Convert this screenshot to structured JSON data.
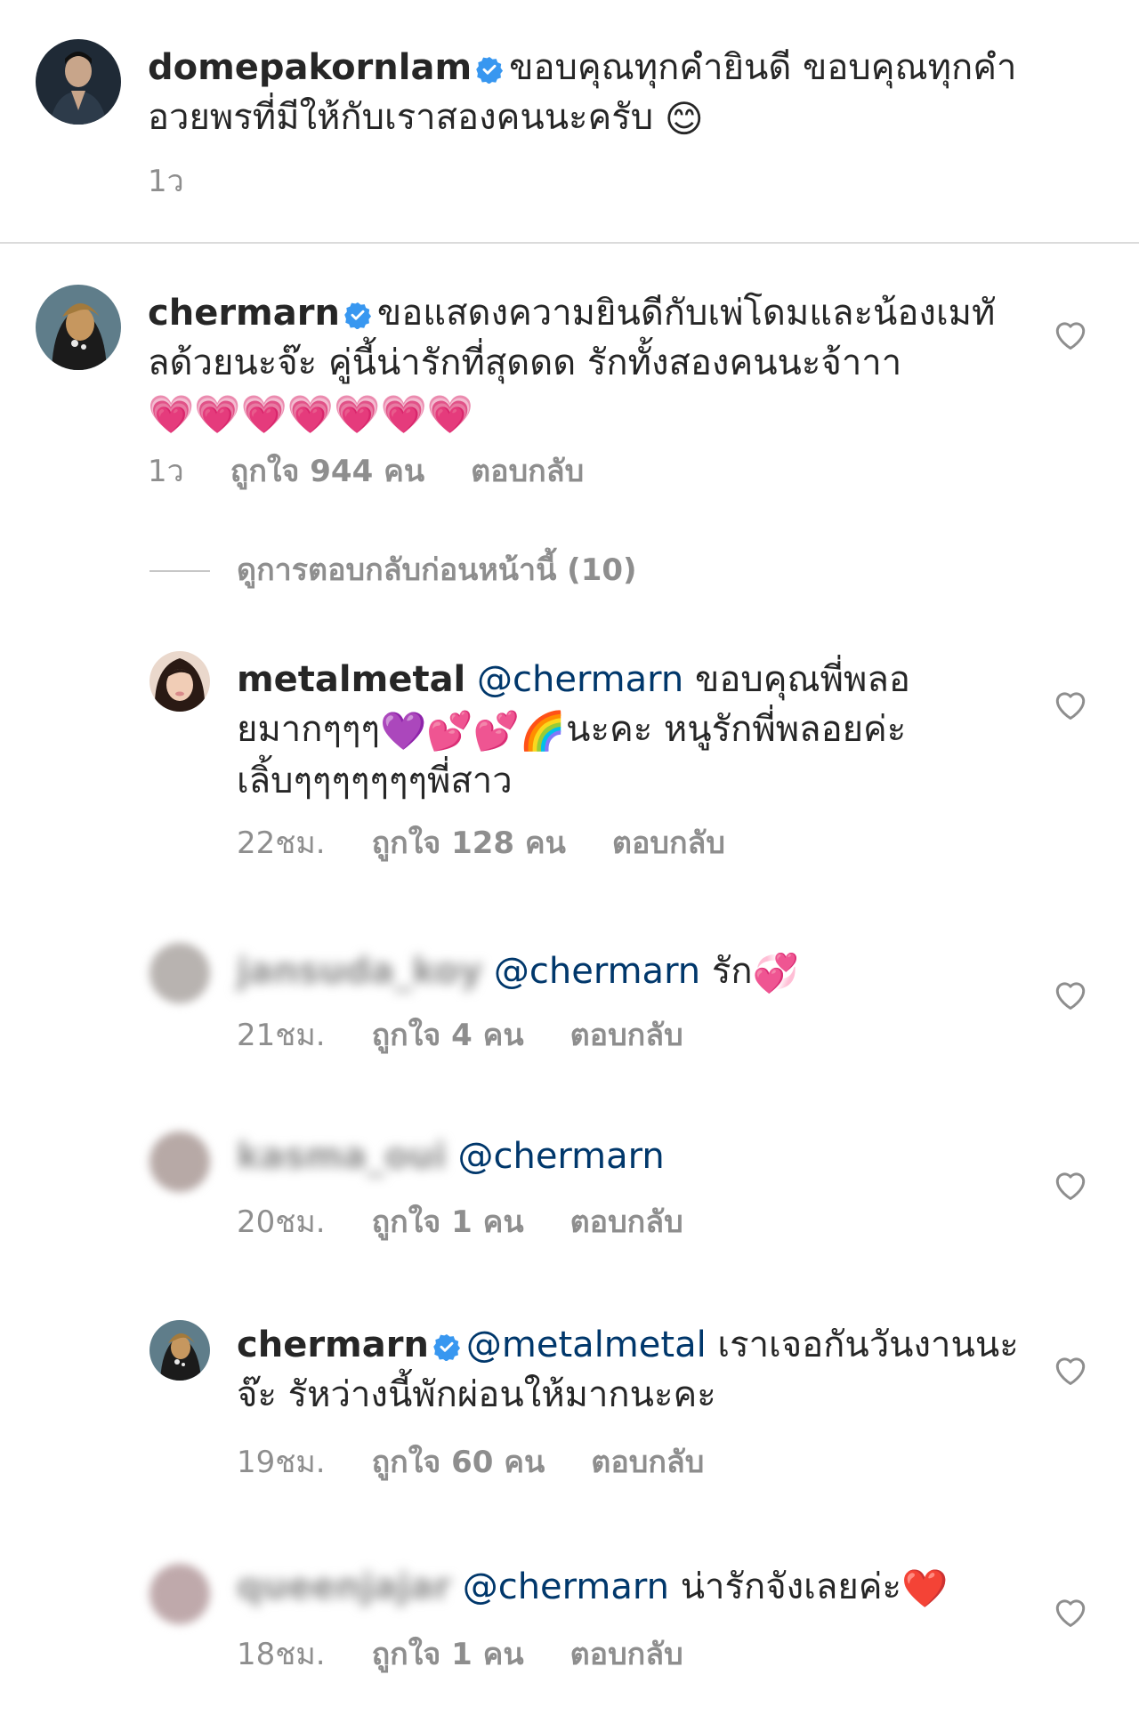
{
  "comments": [
    {
      "username": "domepakornlam",
      "text": "ขอบคุณทุกคำยินดี ขอบคุณทุกคำอวยพรที่มีให้กับเราสองคนนะครับ",
      "emoji": "😊",
      "time": "1ว"
    },
    {
      "username": "chermarn",
      "text": "ขอแสดงความยินดีกับเพ่โดมและน้องเมทัลด้วยนะจ๊ะ คู่นี้น่ารักที่สุดดด รักทั้งสองคนนะจ้าาา",
      "emoji": "💗💗💗💗💗💗💗",
      "time": "1ว",
      "likes": "ถูกใจ 944 คน",
      "reply": "ตอบกลับ"
    }
  ],
  "view_replies": "ดูการตอบกลับก่อนหน้านี้ (10)",
  "replies": [
    {
      "username": "metalmetal",
      "mention": "@chermarn",
      "text_a": "ขอบคุณพี่พลอยมากๆๆๆ",
      "emoji": "💜💕💕🌈",
      "text_b": "นะคะ หนูรักพี่พลอยค่ะเลิ้บๆๆๆๆๆๆๆพี่สาว",
      "time": "22ชม.",
      "likes": "ถูกใจ 128 คน",
      "reply": "ตอบกลับ"
    },
    {
      "username": "jansuda_koy",
      "mention": "@chermarn",
      "text": "รัก",
      "emoji": "💞",
      "time": "21ชม.",
      "likes": "ถูกใจ 4 คน",
      "reply": "ตอบกลับ"
    },
    {
      "username": "kasma_oui",
      "mention": "@chermarn",
      "time": "20ชม.",
      "likes": "ถูกใจ 1 คน",
      "reply": "ตอบกลับ"
    },
    {
      "username": "chermarn",
      "mention": "@metalmetal",
      "text": "เราเจอกันวันงานนะจ๊ะ รัหว่างนี้พักผ่อนให้มากนะคะ",
      "time": "19ชม.",
      "likes": "ถูกใจ 60 คน",
      "reply": "ตอบกลับ"
    },
    {
      "username": "queenjajar",
      "mention": "@chermarn",
      "text": "น่ารักจังเลยค่ะ",
      "emoji": "❤️",
      "time": "18ชม.",
      "likes": "ถูกใจ 1 คน",
      "reply": "ตอบกลับ"
    }
  ],
  "colors": {
    "text": "#262626",
    "meta": "#8e8e8e",
    "mention": "#00376b",
    "verified": "#3897f0",
    "divider": "#dbdbdb"
  },
  "icons": {
    "verified": "verified-badge-icon",
    "like": "heart-outline-icon"
  }
}
